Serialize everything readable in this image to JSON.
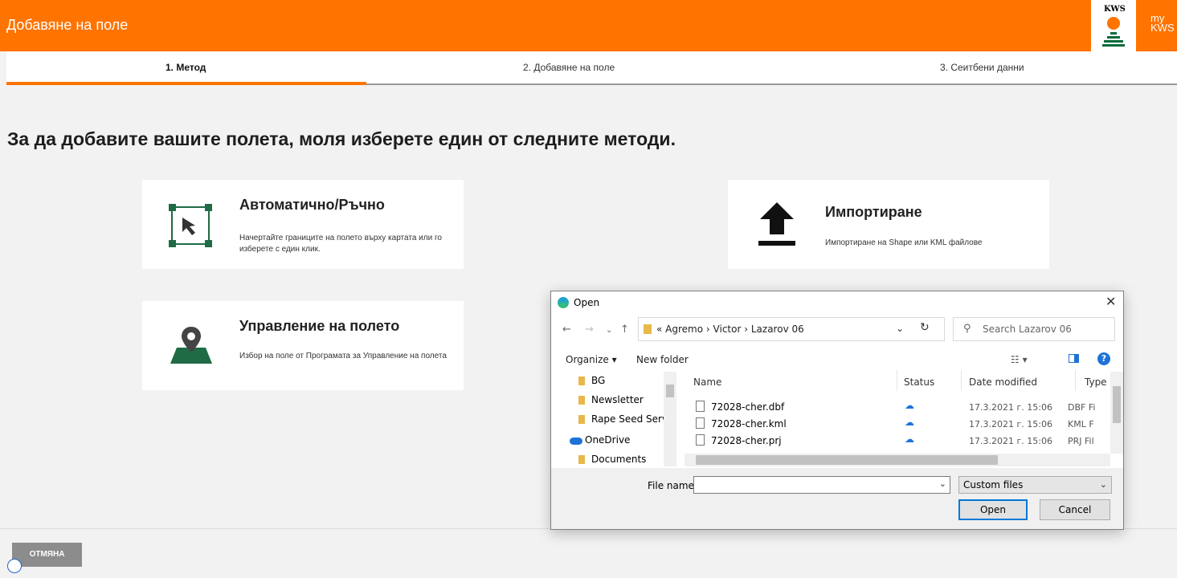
{
  "header": {
    "title": "Добавяне на поле",
    "logo_text": "KWS",
    "my_kws": "my KWS"
  },
  "steps": [
    {
      "label": "1. Метод",
      "active": true
    },
    {
      "label": "2. Добавяне на поле",
      "active": false
    },
    {
      "label": "3. Сеитбени данни",
      "active": false
    }
  ],
  "heading": "За да добавите вашите полета, моля изберете един от следните методи.",
  "methods": {
    "auto": {
      "title": "Автоматично/Ръчно",
      "description": "Начертайте границите на полето върху картата или го изберете с един клик.",
      "icon": "select-area-icon"
    },
    "import": {
      "title": "Импортиране",
      "description": "Импортиране на Shape или KML файлове",
      "icon": "upload-icon"
    },
    "manage": {
      "title": "Управление на полето",
      "description": "Избор на поле от Програмата за Управление на полета",
      "icon": "map-pin-icon"
    }
  },
  "cancel_button": "ОТМЯНА",
  "dialog": {
    "title": "Open",
    "address": {
      "prefix": "«",
      "crumbs": [
        "Agremo",
        "Victor",
        "Lazarov 06"
      ]
    },
    "search_placeholder": "Search Lazarov 06",
    "organize": "Organize ▾",
    "new_folder": "New folder",
    "tree": [
      {
        "label": "BG",
        "icon": "folder-icon"
      },
      {
        "label": "Newsletter",
        "icon": "folder-icon"
      },
      {
        "label": "Rape Seed Servi",
        "icon": "folder-icon"
      },
      {
        "label": "OneDrive",
        "icon": "cloud-icon"
      },
      {
        "label": "Documents",
        "icon": "folder-icon"
      }
    ],
    "columns": {
      "name": "Name",
      "status": "Status",
      "date": "Date modified",
      "type": "Type"
    },
    "files": [
      {
        "name": "72028-cher.dbf",
        "status": "cloud-icon",
        "date": "17.3.2021 г. 15:06",
        "type": "DBF Fi"
      },
      {
        "name": "72028-cher.kml",
        "status": "cloud-icon",
        "date": "17.3.2021 г. 15:06",
        "type": "KML F"
      },
      {
        "name": "72028-cher.prj",
        "status": "cloud-icon",
        "date": "17.3.2021 г. 15:06",
        "type": "PRJ Fil"
      }
    ],
    "file_name_label": "File name:",
    "file_name_value": "",
    "filter": "Custom files",
    "open_button": "Open",
    "cancel_button": "Cancel"
  },
  "colors": {
    "accent": "#ff7300",
    "icon_green": "#1f6b45"
  }
}
